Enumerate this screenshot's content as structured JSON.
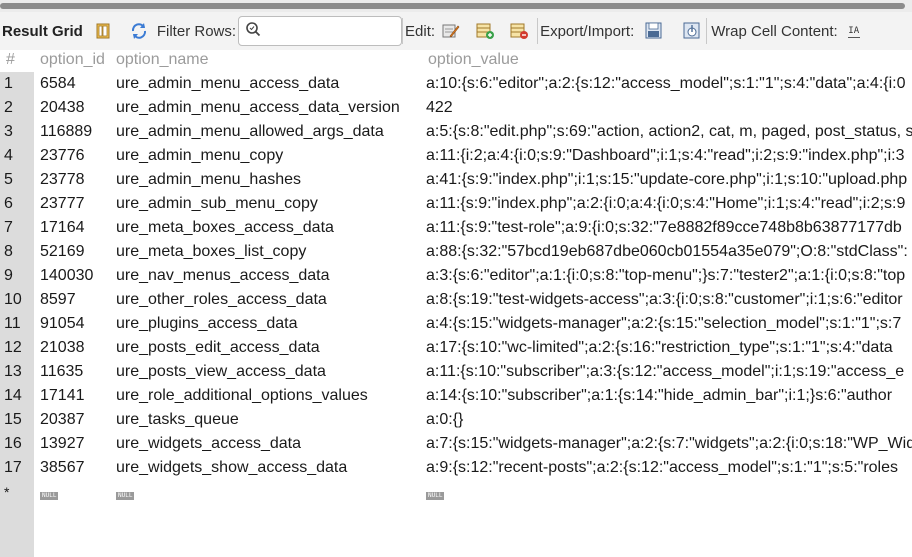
{
  "toolbar": {
    "result_grid_label": "Result Grid",
    "filter_rows_label": "Filter Rows:",
    "filter_value": "",
    "edit_label": "Edit:",
    "export_import_label": "Export/Import:",
    "wrap_label": "Wrap Cell Content:",
    "wrap_icon_text": "IA"
  },
  "columns": {
    "rownum": "#",
    "option_id": "option_id",
    "option_name": "option_name",
    "option_value": "option_value"
  },
  "rows": [
    {
      "n": "1",
      "id": "6584",
      "name": "ure_admin_menu_access_data",
      "value": "a:10:{s:6:\"editor\";a:2:{s:12:\"access_model\";s:1:\"1\";s:4:\"data\";a:4:{i:0"
    },
    {
      "n": "2",
      "id": "20438",
      "name": "ure_admin_menu_access_data_version",
      "value": "422"
    },
    {
      "n": "3",
      "id": "116889",
      "name": "ure_admin_menu_allowed_args_data",
      "value": "a:5:{s:8:\"edit.php\";s:69:\"action, action2, cat, m, paged, post_status, s"
    },
    {
      "n": "4",
      "id": "23776",
      "name": "ure_admin_menu_copy",
      "value": "a:11:{i:2;a:4:{i:0;s:9:\"Dashboard\";i:1;s:4:\"read\";i:2;s:9:\"index.php\";i:3"
    },
    {
      "n": "5",
      "id": "23778",
      "name": "ure_admin_menu_hashes",
      "value": "a:41:{s:9:\"index.php\";i:1;s:15:\"update-core.php\";i:1;s:10:\"upload.php"
    },
    {
      "n": "6",
      "id": "23777",
      "name": "ure_admin_sub_menu_copy",
      "value": "a:11:{s:9:\"index.php\";a:2:{i:0;a:4:{i:0;s:4:\"Home\";i:1;s:4:\"read\";i:2;s:9"
    },
    {
      "n": "7",
      "id": "17164",
      "name": "ure_meta_boxes_access_data",
      "value": "a:11:{s:9:\"test-role\";a:9:{i:0;s:32:\"7e8882f89cce748b8b63877177db"
    },
    {
      "n": "8",
      "id": "52169",
      "name": "ure_meta_boxes_list_copy",
      "value": "a:88:{s:32:\"57bcd19eb687dbe060cb01554a35e079\";O:8:\"stdClass\":"
    },
    {
      "n": "9",
      "id": "140030",
      "name": "ure_nav_menus_access_data",
      "value": "a:3:{s:6:\"editor\";a:1:{i:0;s:8:\"top-menu\";}s:7:\"tester2\";a:1:{i:0;s:8:\"top"
    },
    {
      "n": "10",
      "id": "8597",
      "name": "ure_other_roles_access_data",
      "value": "a:8:{s:19:\"test-widgets-access\";a:3:{i:0;s:8:\"customer\";i:1;s:6:\"editor"
    },
    {
      "n": "11",
      "id": "91054",
      "name": "ure_plugins_access_data",
      "value": "a:4:{s:15:\"widgets-manager\";a:2:{s:15:\"selection_model\";s:1:\"1\";s:7"
    },
    {
      "n": "12",
      "id": "21038",
      "name": "ure_posts_edit_access_data",
      "value": "a:17:{s:10:\"wc-limited\";a:2:{s:16:\"restriction_type\";s:1:\"1\";s:4:\"data"
    },
    {
      "n": "13",
      "id": "11635",
      "name": "ure_posts_view_access_data",
      "value": "a:11:{s:10:\"subscriber\";a:3:{s:12:\"access_model\";i:1;s:19:\"access_e"
    },
    {
      "n": "14",
      "id": "17141",
      "name": "ure_role_additional_options_values",
      "value": "a:14:{s:10:\"subscriber\";a:1:{s:14:\"hide_admin_bar\";i:1;}s:6:\"author"
    },
    {
      "n": "15",
      "id": "20387",
      "name": "ure_tasks_queue",
      "value": "a:0:{}"
    },
    {
      "n": "16",
      "id": "13927",
      "name": "ure_widgets_access_data",
      "value": "a:7:{s:15:\"widgets-manager\";a:2:{s:7:\"widgets\";a:2:{i:0;s:18:\"WP_Wid"
    },
    {
      "n": "17",
      "id": "38567",
      "name": "ure_widgets_show_access_data",
      "value": "a:9:{s:12:\"recent-posts\";a:2:{s:12:\"access_model\";s:1:\"1\";s:5:\"roles"
    }
  ],
  "new_row": {
    "marker": "*",
    "null_label": "NULL"
  },
  "icons": {
    "form_editor": "form-editor-icon",
    "refresh": "refresh-icon",
    "search": "search-icon",
    "edit_row": "edit-row-icon",
    "add_row": "add-row-icon",
    "delete_row": "delete-row-icon",
    "export": "export-icon",
    "import": "import-icon",
    "wrap": "wrap-cell-icon"
  },
  "colors": {
    "toolbar_bg": "#f3f3f3",
    "rownum_bg": "#dcdcdc",
    "header_text": "#9b9b9b",
    "null_badge": "#9a9a9a",
    "accent_blue": "#3b7bd4"
  }
}
